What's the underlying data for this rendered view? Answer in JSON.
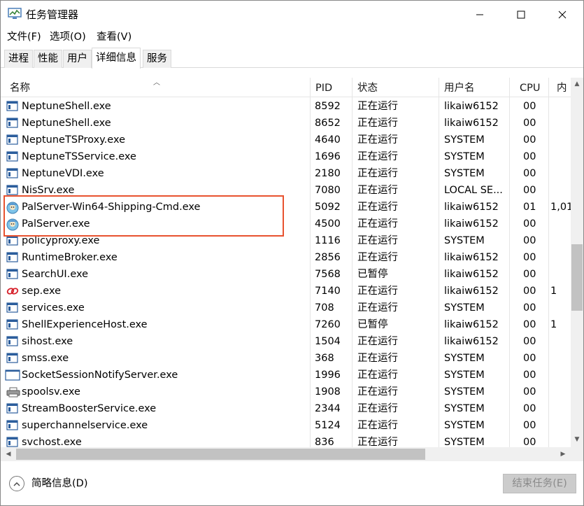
{
  "window": {
    "title": "任务管理器"
  },
  "menu": {
    "file": "文件(F)",
    "options": "选项(O)",
    "view": "查看(V)"
  },
  "tabs": [
    {
      "label": "进程",
      "active": false
    },
    {
      "label": "性能",
      "active": false
    },
    {
      "label": "用户",
      "active": false
    },
    {
      "label": "详细信息",
      "active": true
    },
    {
      "label": "服务",
      "active": false
    }
  ],
  "columns": {
    "name": "名称",
    "pid": "PID",
    "status": "状态",
    "user": "用户名",
    "cpu": "CPU",
    "mem": "内"
  },
  "rows": [
    {
      "name": "NeptuneShell.exe",
      "pid": "8592",
      "status": "正在运行",
      "user": "likaiw6152",
      "cpu": "00",
      "mem": "",
      "icon": "exe-icon"
    },
    {
      "name": "NeptuneShell.exe",
      "pid": "8652",
      "status": "正在运行",
      "user": "likaiw6152",
      "cpu": "00",
      "mem": "",
      "icon": "exe-icon"
    },
    {
      "name": "NeptuneTSProxy.exe",
      "pid": "4640",
      "status": "正在运行",
      "user": "SYSTEM",
      "cpu": "00",
      "mem": "",
      "icon": "exe-icon"
    },
    {
      "name": "NeptuneTSService.exe",
      "pid": "1696",
      "status": "正在运行",
      "user": "SYSTEM",
      "cpu": "00",
      "mem": "",
      "icon": "exe-icon"
    },
    {
      "name": "NeptuneVDI.exe",
      "pid": "2180",
      "status": "正在运行",
      "user": "SYSTEM",
      "cpu": "00",
      "mem": "",
      "icon": "exe-icon"
    },
    {
      "name": "NisSrv.exe",
      "pid": "7080",
      "status": "正在运行",
      "user": "LOCAL SE...",
      "cpu": "00",
      "mem": "",
      "icon": "exe-icon"
    },
    {
      "name": "PalServer-Win64-Shipping-Cmd.exe",
      "pid": "5092",
      "status": "正在运行",
      "user": "likaiw6152",
      "cpu": "01",
      "mem": "1,01",
      "icon": "palworld-icon"
    },
    {
      "name": "PalServer.exe",
      "pid": "4500",
      "status": "正在运行",
      "user": "likaiw6152",
      "cpu": "00",
      "mem": "",
      "icon": "palworld-icon"
    },
    {
      "name": "policyproxy.exe",
      "pid": "1116",
      "status": "正在运行",
      "user": "SYSTEM",
      "cpu": "00",
      "mem": "",
      "icon": "exe-icon"
    },
    {
      "name": "RuntimeBroker.exe",
      "pid": "2856",
      "status": "正在运行",
      "user": "likaiw6152",
      "cpu": "00",
      "mem": "",
      "icon": "exe-icon"
    },
    {
      "name": "SearchUI.exe",
      "pid": "7568",
      "status": "已暂停",
      "user": "likaiw6152",
      "cpu": "00",
      "mem": "",
      "icon": "exe-icon"
    },
    {
      "name": "sep.exe",
      "pid": "7140",
      "status": "正在运行",
      "user": "likaiw6152",
      "cpu": "00",
      "mem": "1",
      "icon": "chain-link-icon"
    },
    {
      "name": "services.exe",
      "pid": "708",
      "status": "正在运行",
      "user": "SYSTEM",
      "cpu": "00",
      "mem": "",
      "icon": "exe-icon"
    },
    {
      "name": "ShellExperienceHost.exe",
      "pid": "7260",
      "status": "已暂停",
      "user": "likaiw6152",
      "cpu": "00",
      "mem": "1",
      "icon": "exe-icon"
    },
    {
      "name": "sihost.exe",
      "pid": "1504",
      "status": "正在运行",
      "user": "likaiw6152",
      "cpu": "00",
      "mem": "",
      "icon": "exe-icon"
    },
    {
      "name": "smss.exe",
      "pid": "368",
      "status": "正在运行",
      "user": "SYSTEM",
      "cpu": "00",
      "mem": "",
      "icon": "exe-icon"
    },
    {
      "name": "SocketSessionNotifyServer.exe",
      "pid": "1996",
      "status": "正在运行",
      "user": "SYSTEM",
      "cpu": "00",
      "mem": "",
      "icon": "window-icon"
    },
    {
      "name": "spoolsv.exe",
      "pid": "1908",
      "status": "正在运行",
      "user": "SYSTEM",
      "cpu": "00",
      "mem": "",
      "icon": "printer-icon"
    },
    {
      "name": "StreamBoosterService.exe",
      "pid": "2344",
      "status": "正在运行",
      "user": "SYSTEM",
      "cpu": "00",
      "mem": "",
      "icon": "exe-icon"
    },
    {
      "name": "superchannelservice.exe",
      "pid": "5124",
      "status": "正在运行",
      "user": "SYSTEM",
      "cpu": "00",
      "mem": "",
      "icon": "exe-icon"
    },
    {
      "name": "svchost.exe",
      "pid": "836",
      "status": "正在运行",
      "user": "SYSTEM",
      "cpu": "00",
      "mem": "",
      "icon": "exe-icon"
    }
  ],
  "footer": {
    "brief": "简略信息(D)",
    "end_task": "结束任务(E)"
  },
  "colors": {
    "highlight": "#e8522f",
    "disabled_button": "#cccccc"
  }
}
